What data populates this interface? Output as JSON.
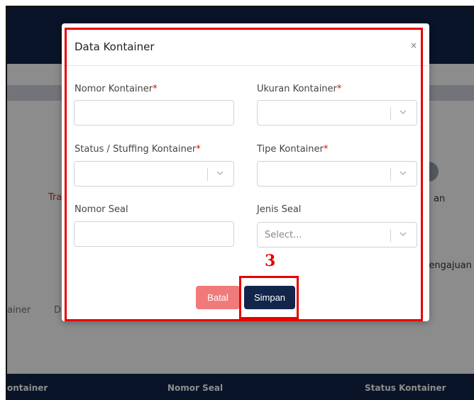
{
  "background": {
    "left_text_1": "Tra",
    "left_text_2": "ainer",
    "left_text_3": "D",
    "right_text_1": "an",
    "right_text_2": "Pengajuan",
    "table_headers": [
      "ontainer",
      "Nomor Seal",
      "Status Kontainer"
    ]
  },
  "modal": {
    "title": "Data Kontainer",
    "close_glyph": "×",
    "required_marker": "*",
    "fields": {
      "nomor_kontainer": {
        "label": "Nomor Kontainer",
        "value": ""
      },
      "ukuran_kontainer": {
        "label": "Ukuran Kontainer",
        "value": ""
      },
      "status_stuffing": {
        "label": "Status / Stuffing Kontainer",
        "value": ""
      },
      "tipe_kontainer": {
        "label": "Tipe Kontainer",
        "value": ""
      },
      "nomor_seal": {
        "label": "Nomor Seal",
        "value": ""
      },
      "jenis_seal": {
        "label": "Jenis Seal",
        "placeholder": "Select..."
      }
    },
    "buttons": {
      "batal": "Batal",
      "simpan": "Simpan"
    }
  },
  "annotation": {
    "step_number": "3",
    "color": "#e60000"
  },
  "colors": {
    "navy": "#12254a",
    "batal": "#f07a7a"
  },
  "icons": [
    "close-icon",
    "chevron-down-icon"
  ]
}
